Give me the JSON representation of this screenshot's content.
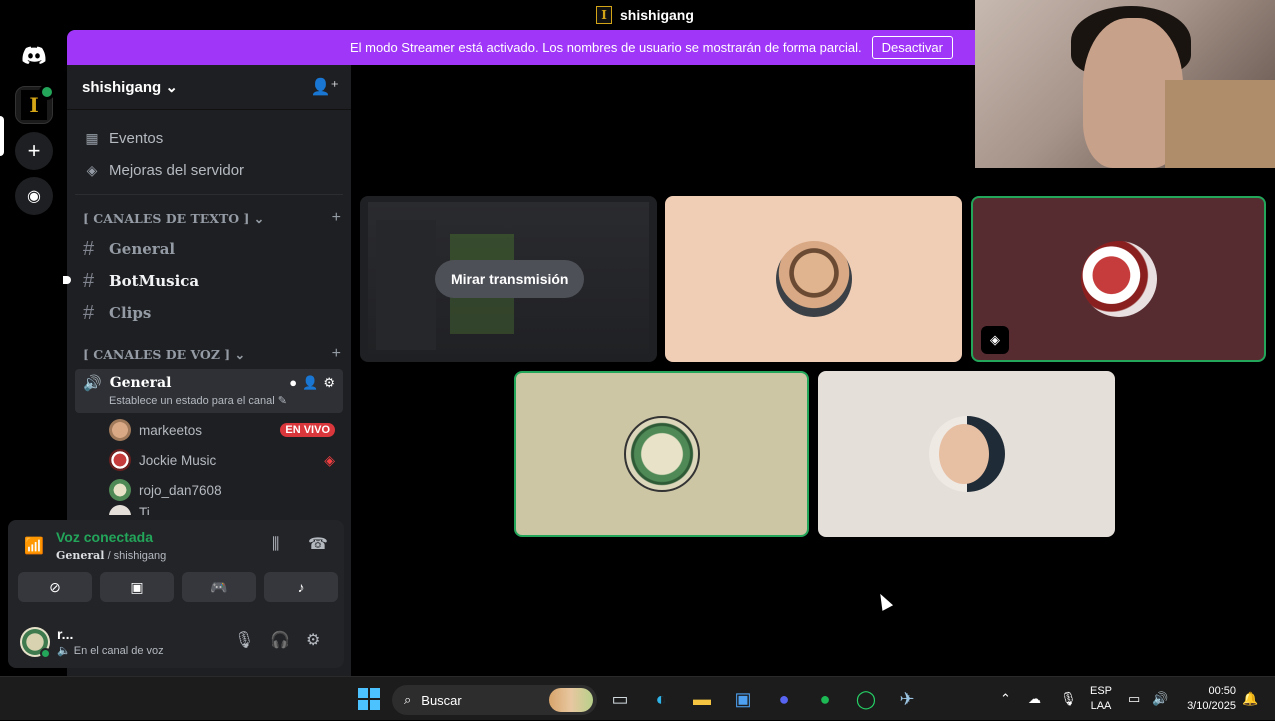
{
  "window": {
    "title": "shishigang"
  },
  "banner": {
    "message": "El modo Streamer está activado. Los nombres de usuario se mostrarán de forma parcial.",
    "button": "Desactivar",
    "color": "#a036f7"
  },
  "guilds": {
    "items": [
      "discord-home-icon",
      "server-shishigang",
      "add-server-icon",
      "explore-icon"
    ]
  },
  "server": {
    "name": "shishigang",
    "links": [
      {
        "label": "Eventos",
        "icon": "calendar-icon"
      },
      {
        "label": "Mejoras del servidor",
        "icon": "boost-icon"
      }
    ],
    "text_category": "[ CANALES DE TEXTO ]",
    "text_channels": [
      {
        "name": "General"
      },
      {
        "name": "BotMusica"
      },
      {
        "name": "Clips"
      }
    ],
    "voice_category": "[ CANALES DE VOZ ]",
    "voice_channel": {
      "name": "General",
      "status_hint": "Establece un estado para el canal"
    },
    "voice_members": [
      {
        "name": "markeetos",
        "badge": "EN VIVO"
      },
      {
        "name": "Jockie Music"
      },
      {
        "name": "rojo_dan7608"
      },
      {
        "name": "Ti..."
      }
    ]
  },
  "voice_panel": {
    "status": "Voz conectada",
    "channel": "General",
    "server": "/ shishigang",
    "buttons": [
      "camera-off-icon",
      "screen-share-icon",
      "activity-icon",
      "soundboard-icon"
    ]
  },
  "user": {
    "name": "r...",
    "status": "En el canal de voz"
  },
  "stage": {
    "watch_label": "Mirar transmisión",
    "speaking_color": "#23a55a"
  },
  "taskbar": {
    "search_placeholder": "Buscar",
    "apps": [
      "file-manager-icon",
      "edge-icon",
      "folder-icon",
      "store-icon",
      "discord-icon",
      "spotify-icon",
      "whatsapp-icon",
      "steam-icon"
    ],
    "lang_line1": "ESP",
    "lang_line2": "LAA",
    "time": "00:50",
    "date": "3/10/2025"
  }
}
